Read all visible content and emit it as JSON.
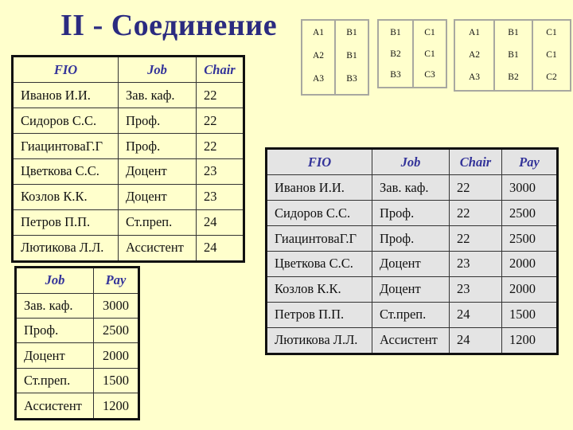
{
  "title": "II - Соединение",
  "mini_tables": [
    {
      "columns": [
        [
          "A1",
          "A2",
          "A3"
        ],
        [
          "B1",
          "B1",
          "B3"
        ]
      ]
    },
    {
      "columns": [
        [
          "B1",
          "B2",
          "B3"
        ],
        [
          "C1",
          "C1",
          "C3"
        ]
      ]
    },
    {
      "columns": [
        [
          "A1",
          "A2",
          "A3"
        ],
        [
          "B1",
          "B1",
          "B2"
        ],
        [
          "C1",
          "C1",
          "C2"
        ]
      ]
    }
  ],
  "staff_table": {
    "headers": [
      "FIO",
      "Job",
      "Chair"
    ],
    "rows": [
      [
        "Иванов И.И.",
        "Зав. каф.",
        "22"
      ],
      [
        "Сидоров С.С.",
        "Проф.",
        "22"
      ],
      [
        "ГиацинтоваГ.Г",
        "Проф.",
        "22"
      ],
      [
        "Цветкова С.С.",
        "Доцент",
        "23"
      ],
      [
        "Козлов К.К.",
        "Доцент",
        "23"
      ],
      [
        "Петров П.П.",
        "Ст.преп.",
        "24"
      ],
      [
        "Лютикова Л.Л.",
        "Ассистент",
        "24"
      ]
    ]
  },
  "pay_table": {
    "headers": [
      "Job",
      "Pay"
    ],
    "rows": [
      [
        "Зав. каф.",
        "3000"
      ],
      [
        "Проф.",
        "2500"
      ],
      [
        "Доцент",
        "2000"
      ],
      [
        "Ст.преп.",
        "1500"
      ],
      [
        "Ассистент",
        "1200"
      ]
    ]
  },
  "joined_table": {
    "headers": [
      "FIO",
      "Job",
      "Chair",
      "Pay"
    ],
    "rows": [
      [
        "Иванов И.И.",
        "Зав. каф.",
        "22",
        "3000"
      ],
      [
        "Сидоров С.С.",
        "Проф.",
        "22",
        "2500"
      ],
      [
        "ГиацинтоваГ.Г",
        "Проф.",
        "22",
        "2500"
      ],
      [
        "Цветкова С.С.",
        "Доцент",
        "23",
        "2000"
      ],
      [
        "Козлов К.К.",
        "Доцент",
        "23",
        "2000"
      ],
      [
        "Петров П.П.",
        "Ст.преп.",
        "24",
        "1500"
      ],
      [
        "Лютикова Л.Л.",
        "Ассистент",
        "24",
        "1200"
      ]
    ]
  }
}
